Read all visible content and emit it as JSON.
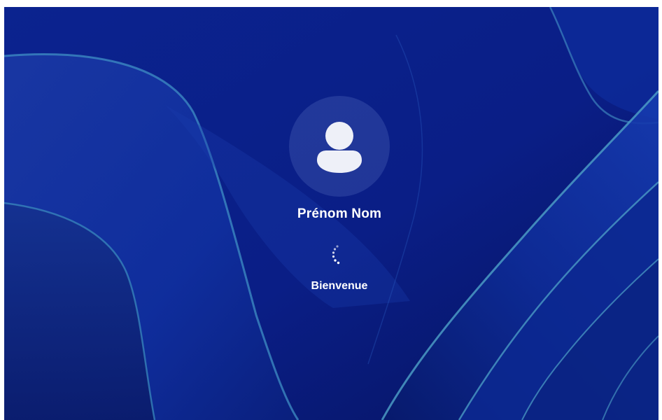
{
  "login": {
    "user_name": "Prénom Nom",
    "status_text": "Bienvenue",
    "avatar_icon": "user-silhouette-icon",
    "spinner_icon": "loading-spinner-icon"
  },
  "colors": {
    "wallpaper_base": "#0a1f8f",
    "ribbon_accent": "#4fa3c8",
    "text": "#ffffff"
  }
}
